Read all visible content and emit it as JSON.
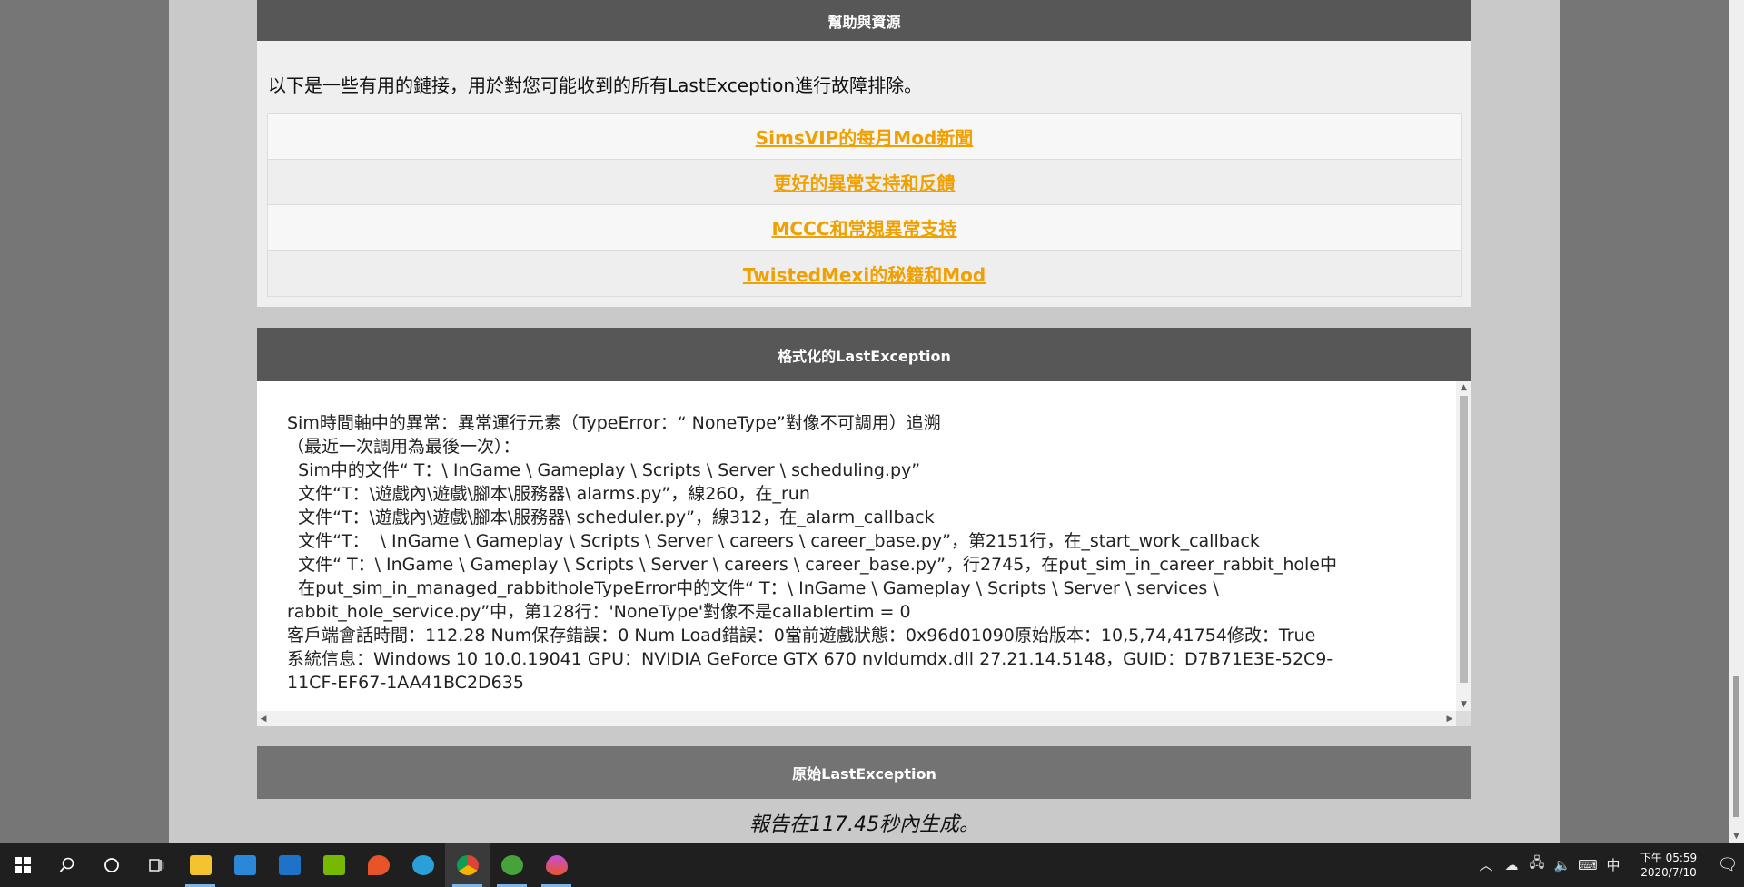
{
  "help": {
    "title": "幫助與資源",
    "intro": "以下是一些有用的鏈接，用於對您可能收到的所有LastException進行故障排除。",
    "links": [
      {
        "label": "SimsVIP的每月Mod新聞"
      },
      {
        "label": "更好的異常支持和反饋"
      },
      {
        "label": "MCCC和常規異常支持"
      },
      {
        "label": "TwistedMexi的秘籍和Mod"
      }
    ],
    "link_color": "#f0a000"
  },
  "formatted": {
    "title": "格式化的LastException",
    "lines": [
      "Sim時間軸中的異常：異常運行元素（TypeError：“ NoneType”對像不可調用）追溯",
      "（最近一次調用為最後一次）：",
      "  Sim中的文件“ T：\\ InGame \\ Gameplay \\ Scripts \\ Server \\ scheduling.py”",
      "  文件“T：\\遊戲內\\遊戲\\腳本\\服務器\\ alarms.py”，線260，在_run",
      "  文件“T：\\遊戲內\\遊戲\\腳本\\服務器\\ scheduler.py”，線312，在_alarm_callback",
      "  文件“T：  \\ InGame \\ Gameplay \\ Scripts \\ Server \\ careers \\ career_base.py”，第2151行，在_start_work_callback",
      "  文件“ T：\\ InGame \\ Gameplay \\ Scripts \\ Server \\ careers \\ career_base.py”，行2745，在put_sim_in_career_rabbit_hole中",
      "  在put_sim_in_managed_rabbitholeTypeError中的文件“ T：\\ InGame \\ Gameplay \\ Scripts \\ Server \\ services \\",
      "rabbit_hole_service.py”中，第128行：'NoneType'對像不是callablertim = 0",
      "客戶端會話時間：112.28 Num保存錯誤：0 Num Load錯誤：0當前遊戲狀態：0x96d01090原始版本：10,5,74,41754修改：True",
      "系統信息：Windows 10 10.0.19041 GPU：NVIDIA GeForce GTX 670 nvldumdx.dll 27.21.14.5148，GUID：D7B71E3E-52C9-",
      "11CF-EF67-1AA41BC2D635"
    ]
  },
  "raw": {
    "title": "原始LastException"
  },
  "footer": {
    "report_time": "報告在117.45秒內生成。"
  },
  "taskbar": {
    "apps": [
      {
        "name": "file-explorer-icon",
        "color": "#f4c430"
      },
      {
        "name": "store-icon",
        "color": "#2b88d8"
      },
      {
        "name": "mail-icon",
        "color": "#1e73c8"
      },
      {
        "name": "nvidia-icon",
        "color": "#76b900"
      },
      {
        "name": "maps-icon",
        "color": "#e8542a"
      },
      {
        "name": "edge-icon",
        "color": "#2aa0d8"
      },
      {
        "name": "chrome-icon",
        "color": "#db4437"
      },
      {
        "name": "sims-icon",
        "color": "#46a33a"
      },
      {
        "name": "paint-icon",
        "color": "#c44fd8"
      }
    ],
    "ime": "中",
    "time": "下午 05:59",
    "date": "2020/7/10"
  }
}
